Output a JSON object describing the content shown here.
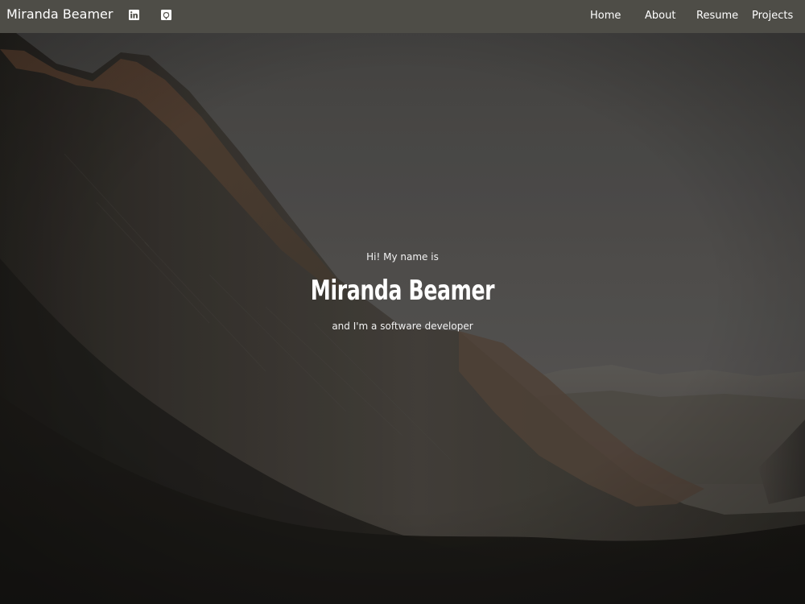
{
  "navbar": {
    "brand": "Miranda Beamer",
    "social": [
      {
        "name": "linkedin",
        "icon": "linkedin-icon"
      },
      {
        "name": "github",
        "icon": "github-icon"
      }
    ],
    "links": [
      "Home",
      "About",
      "Resume",
      "Projects"
    ],
    "background": "#4e4d47",
    "text_color": "#ffffff"
  },
  "hero": {
    "intro": "Hi! My name is",
    "name": "Miranda Beamer",
    "tagline": "and I'm a software developer",
    "background_image": "mountain-valley-photo"
  }
}
